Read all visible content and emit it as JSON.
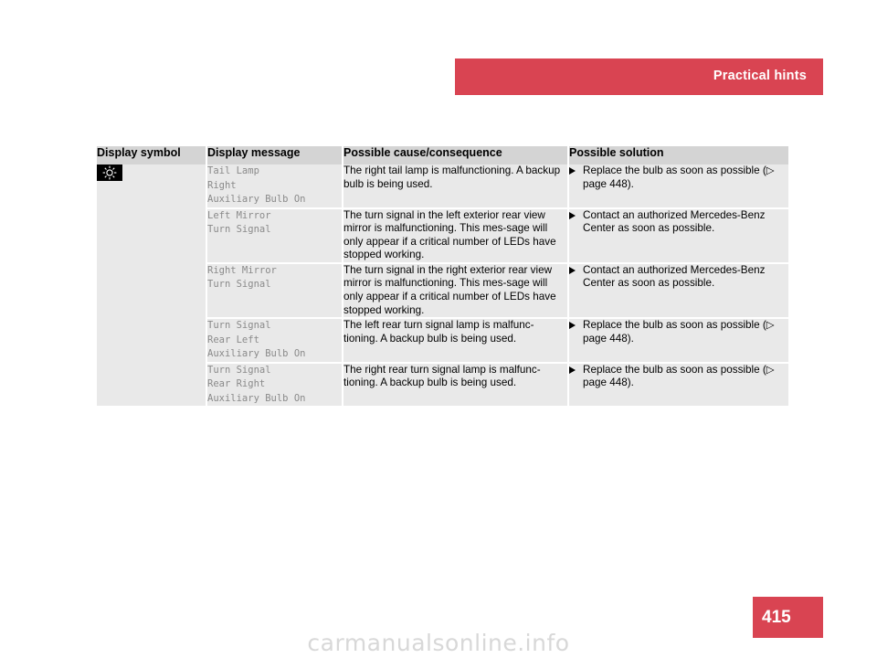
{
  "header": {
    "title": "Practical hints"
  },
  "page_number": "415",
  "watermark": "carmanualsonline.info",
  "colors": {
    "accent_red": "#d94452",
    "header_cell": "#d4d4d4",
    "cell": "#e9e9e9",
    "message_text": "#8a8a8a"
  },
  "table": {
    "columns": [
      "Display symbol",
      "Display message",
      "Possible cause/consequence",
      "Possible solution"
    ],
    "rows": [
      {
        "symbol": "tail-lamp-indicator-icon",
        "message": "Tail Lamp\nRight\nAuxiliary Bulb On",
        "cause": "The right tail lamp is malfunctioning. A backup bulb is being used.",
        "solution": "Replace the bulb as soon as possible",
        "solution_ref": "(▷ page 448)."
      },
      {
        "symbol": "",
        "message": "Left Mirror\nTurn Signal",
        "cause": "The turn signal in the left exterior rear view mirror is malfunctioning. This mes-sage will only appear if a critical number of LEDs have stopped working.",
        "solution": "Contact an authorized Mercedes-Benz Center as soon as possible.",
        "solution_ref": ""
      },
      {
        "symbol": "",
        "message": "Right Mirror\nTurn Signal",
        "cause": "The turn signal in the right exterior rear view mirror is malfunctioning. This mes-sage will only appear if a critical number of LEDs have stopped working.",
        "solution": "Contact an authorized Mercedes-Benz Center as soon as possible.",
        "solution_ref": ""
      },
      {
        "symbol": "",
        "message": "Turn Signal\nRear Left\nAuxiliary Bulb On",
        "cause": "The left rear turn signal lamp is malfunc-tioning. A backup bulb is being used.",
        "solution": "Replace the bulb as soon as possible",
        "solution_ref": "(▷ page 448)."
      },
      {
        "symbol": "",
        "message": "Turn Signal\nRear Right\nAuxiliary Bulb On",
        "cause": "The right rear turn signal lamp is malfunc-tioning. A backup bulb is being used.",
        "solution": "Replace the bulb as soon as possible",
        "solution_ref": "(▷ page 448)."
      }
    ]
  }
}
